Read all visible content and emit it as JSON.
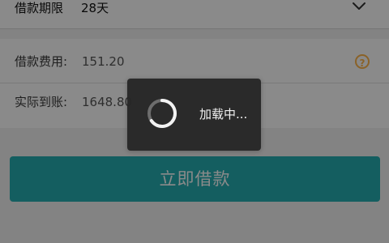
{
  "loan_term": {
    "label": "借款期限",
    "value": "28天",
    "dropdown_icon": "chevron-down-icon"
  },
  "fees": {
    "fee_label": "借款费用:",
    "fee_value": "151.20",
    "help_icon": "help-icon",
    "help_icon_symbol": "?",
    "actual_label": "实际到账:",
    "actual_value": "1648.80"
  },
  "action": {
    "submit_label": "立即借款",
    "button_color": "#25aeb1"
  },
  "loading": {
    "text": "加载中...",
    "spinner_icon": "loading-spinner-icon"
  }
}
